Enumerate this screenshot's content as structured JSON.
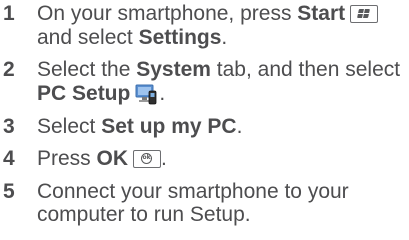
{
  "steps": [
    {
      "number": "1",
      "t1": "On your smartphone, press ",
      "b1": "Start",
      "t2": "and select ",
      "b2": "Settings",
      "t3": ".",
      "icon": "windows-start-key-icon"
    },
    {
      "number": "2",
      "t1": "Select the ",
      "b1": "System",
      "t2": " tab, and then select",
      "b2": "PC Setup",
      "icon": "pc-setup-icon"
    },
    {
      "number": "3",
      "t1": "Select ",
      "b1": "Set up my PC",
      "t2": "."
    },
    {
      "number": "4",
      "t1": "Press ",
      "b1": "OK",
      "t2": ".",
      "icon": "ok-key-icon",
      "icon_label": "ok"
    },
    {
      "number": "5",
      "text": "Connect your smartphone to your computer to run Setup."
    }
  ],
  "colors": {
    "text": "#4d4d4f",
    "icon_blue": "#5a8fd0"
  }
}
